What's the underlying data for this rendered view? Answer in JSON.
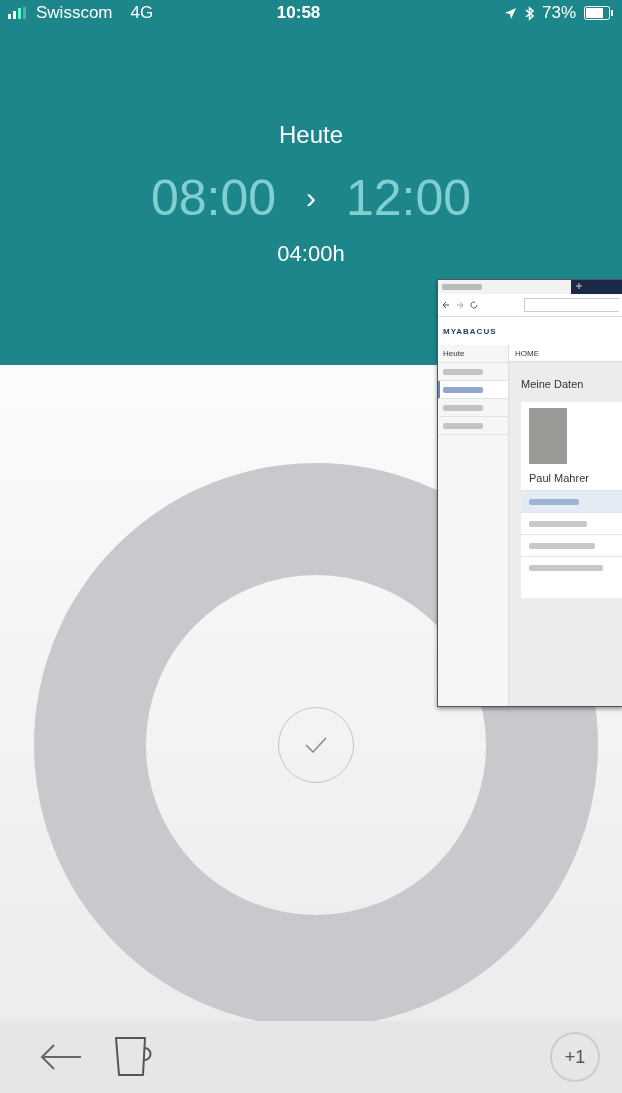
{
  "status_bar": {
    "carrier": "Swisscom",
    "network": "4G",
    "time": "10:58",
    "battery": "73%"
  },
  "header": {
    "day": "Heute",
    "start": "08:00",
    "separator": "›",
    "end": "12:00",
    "duration": "04:00h"
  },
  "bottom_bar": {
    "plus_label": "+1"
  },
  "browser_window": {
    "logo": "MYABACUS",
    "breadcrumb": "HOME",
    "sidebar_items": [
      {
        "label": "Heute",
        "selected": false
      },
      {
        "selected": false
      },
      {
        "selected": true
      },
      {
        "selected": false
      },
      {
        "selected": false
      }
    ],
    "heading": "Meine Daten",
    "person_name": "Paul Mahrer",
    "list_rows": [
      {
        "selected": true
      },
      {
        "selected": false
      },
      {
        "selected": false
      },
      {
        "selected": false
      }
    ]
  }
}
